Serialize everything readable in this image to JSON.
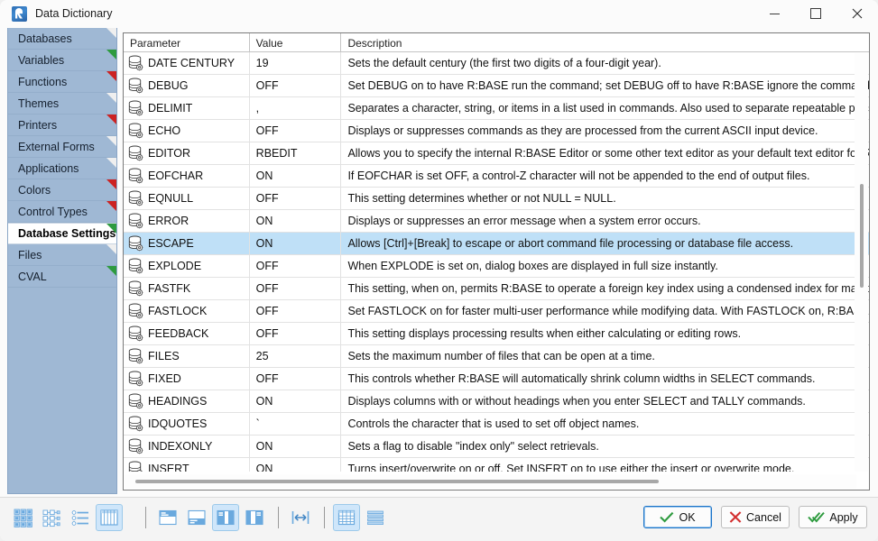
{
  "window": {
    "title": "Data Dictionary",
    "app_icon": "rbase-logo-icon",
    "minimize_label": "Minimize",
    "maximize_label": "Maximize",
    "close_label": "Close"
  },
  "sidebar": {
    "items": [
      {
        "label": "Databases",
        "marker": "#efefef",
        "active": false
      },
      {
        "label": "Variables",
        "marker": "#2e9b3f",
        "active": false
      },
      {
        "label": "Functions",
        "marker": "#cc2222",
        "active": false
      },
      {
        "label": "Themes",
        "marker": "#efefef",
        "active": false
      },
      {
        "label": "Printers",
        "marker": "#cc2222",
        "active": false
      },
      {
        "label": "External Forms",
        "marker": "#efefef",
        "active": false
      },
      {
        "label": "Applications",
        "marker": "#efefef",
        "active": false
      },
      {
        "label": "Colors",
        "marker": "#cc2222",
        "active": false
      },
      {
        "label": "Control Types",
        "marker": "#cc2222",
        "active": false
      },
      {
        "label": "Database Settings",
        "marker": "#2e9b3f",
        "active": true
      },
      {
        "label": "Files",
        "marker": "#efefef",
        "active": false
      },
      {
        "label": "CVAL",
        "marker": "#2e9b3f",
        "active": false
      }
    ]
  },
  "grid": {
    "columns": [
      "Parameter",
      "Value",
      "Description"
    ],
    "selected_index": 8,
    "row_icon": "database-settings-icon",
    "rows": [
      {
        "parameter": "DATE CENTURY",
        "value": "19",
        "description": "Sets the default century (the first two digits of a four-digit year)."
      },
      {
        "parameter": "DEBUG",
        "value": "OFF",
        "description": "Set DEBUG on to have R:BASE run the command; set DEBUG off to have R:BASE ignore the command."
      },
      {
        "parameter": "DELIMIT",
        "value": ",",
        "description": "Separates a character, string, or items in a list used in commands. Also used to separate repeatable parts of"
      },
      {
        "parameter": "ECHO",
        "value": "OFF",
        "description": "Displays or suppresses commands as they are processed from the current ASCII input device."
      },
      {
        "parameter": "EDITOR",
        "value": "RBEDIT",
        "description": "Allows you to specify the internal R:BASE Editor or some other text editor as your default text editor for R:B"
      },
      {
        "parameter": "EOFCHAR",
        "value": "ON",
        "description": "If EOFCHAR is set OFF, a control-Z character will not be appended to the end of output files."
      },
      {
        "parameter": "EQNULL",
        "value": "OFF",
        "description": "This setting determines whether or not NULL = NULL."
      },
      {
        "parameter": "ERROR",
        "value": "ON",
        "description": "Displays or suppresses an error message when a system error occurs."
      },
      {
        "parameter": "ESCAPE",
        "value": "ON",
        "description": "Allows [Ctrl]+[Break] to escape or abort command file processing or database file access."
      },
      {
        "parameter": "EXPLODE",
        "value": "OFF",
        "description": "When EXPLODE is set on, dialog boxes are displayed in full size instantly."
      },
      {
        "parameter": "FASTFK",
        "value": "OFF",
        "description": "This setting, when on, permits R:BASE to operate a foreign key index using a condensed index for maintain"
      },
      {
        "parameter": "FASTLOCK",
        "value": "OFF",
        "description": "Set FASTLOCK on for faster multi-user performance while modifying data. With FASTLOCK on, R:BASE doe"
      },
      {
        "parameter": "FEEDBACK",
        "value": "OFF",
        "description": "This setting displays processing results when either calculating or editing rows."
      },
      {
        "parameter": "FILES",
        "value": "25",
        "description": "Sets the maximum number of files that can be open at a time."
      },
      {
        "parameter": "FIXED",
        "value": "OFF",
        "description": "This controls whether R:BASE will automatically shrink column widths in SELECT commands."
      },
      {
        "parameter": "HEADINGS",
        "value": "ON",
        "description": "Displays columns with or without headings when you enter SELECT and TALLY commands."
      },
      {
        "parameter": "IDQUOTES",
        "value": "`",
        "description": "Controls the character that is used to set off object names."
      },
      {
        "parameter": "INDEXONLY",
        "value": "ON",
        "description": "Sets a flag to disable \"index only\" select retrievals."
      },
      {
        "parameter": "INSERT",
        "value": "ON",
        "description": "Turns insert/overwrite on or off. Set INSERT on to use either the insert or overwrite mode."
      }
    ]
  },
  "toolbar": {
    "items": [
      {
        "name": "large-icons-view-icon",
        "active": false
      },
      {
        "name": "list-tree-view-icon",
        "active": false
      },
      {
        "name": "detail-list-view-icon",
        "active": false
      },
      {
        "name": "grid-columns-view-icon",
        "active": true
      },
      {
        "name": "separator",
        "active": false
      },
      {
        "name": "layout-top-panel-icon",
        "active": false
      },
      {
        "name": "layout-bottom-panel-icon",
        "active": false
      },
      {
        "name": "layout-left-panel-icon",
        "active": true
      },
      {
        "name": "layout-right-panel-icon",
        "active": false
      },
      {
        "name": "separator",
        "active": false
      },
      {
        "name": "fit-width-icon",
        "active": false
      },
      {
        "name": "separator",
        "active": false
      },
      {
        "name": "show-grid-lines-icon",
        "active": true
      },
      {
        "name": "show-row-lines-icon",
        "active": false
      }
    ]
  },
  "actions": {
    "ok_label": "OK",
    "cancel_label": "Cancel",
    "apply_label": "Apply"
  },
  "colors": {
    "sidebar_bg": "#9fb8d4",
    "selection": "#bfe0f7",
    "accent": "#1a73c8",
    "ok_check": "#2e9b3f",
    "cancel_x": "#d32f2f"
  }
}
